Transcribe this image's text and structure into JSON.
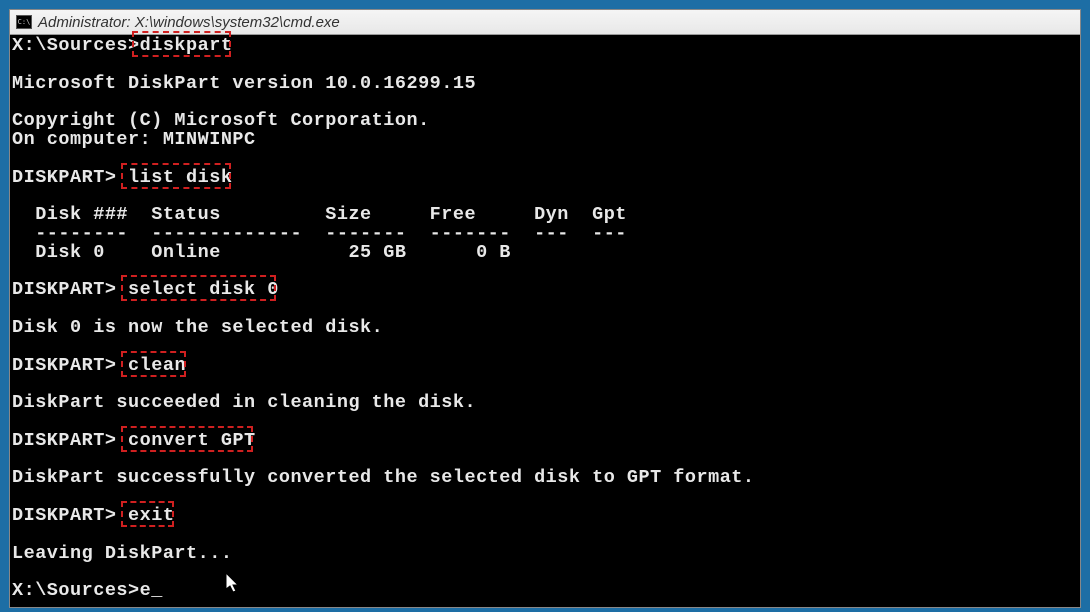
{
  "titlebar": {
    "icon_label": "C:\\",
    "text": "Administrator: X:\\windows\\system32\\cmd.exe"
  },
  "terminal": {
    "lines": [
      {
        "prompt": "X:\\Sources>",
        "cmd": "diskpart",
        "highlighted": true
      },
      {
        "text": ""
      },
      {
        "text": "Microsoft DiskPart version 10.0.16299.15"
      },
      {
        "text": ""
      },
      {
        "text": "Copyright (C) Microsoft Corporation."
      },
      {
        "text": "On computer: MINWINPC"
      },
      {
        "text": ""
      },
      {
        "prompt": "DISKPART> ",
        "cmd": "list disk",
        "highlighted": true
      },
      {
        "text": ""
      },
      {
        "text": "  Disk ###  Status         Size     Free     Dyn  Gpt"
      },
      {
        "text": "  --------  -------------  -------  -------  ---  ---"
      },
      {
        "text": "  Disk 0    Online           25 GB      0 B"
      },
      {
        "text": ""
      },
      {
        "prompt": "DISKPART> ",
        "cmd": "select disk 0",
        "highlighted": true
      },
      {
        "text": ""
      },
      {
        "text": "Disk 0 is now the selected disk."
      },
      {
        "text": ""
      },
      {
        "prompt": "DISKPART> ",
        "cmd": "clean",
        "highlighted": true
      },
      {
        "text": ""
      },
      {
        "text": "DiskPart succeeded in cleaning the disk."
      },
      {
        "text": ""
      },
      {
        "prompt": "DISKPART> ",
        "cmd": "convert GPT",
        "highlighted": true
      },
      {
        "text": ""
      },
      {
        "text": "DiskPart successfully converted the selected disk to GPT format."
      },
      {
        "text": ""
      },
      {
        "prompt": "DISKPART> ",
        "cmd": "exit",
        "highlighted": true
      },
      {
        "text": ""
      },
      {
        "text": "Leaving DiskPart..."
      },
      {
        "text": ""
      },
      {
        "prompt": "X:\\Sources>",
        "cmd": "e",
        "cursor": true
      }
    ]
  }
}
